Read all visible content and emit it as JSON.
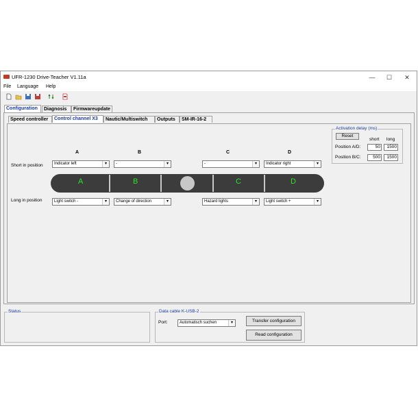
{
  "window": {
    "title": "UFR-1230 Drive-Teacher V1.11a"
  },
  "window_controls": {
    "minimize": "—",
    "maximize": "☐",
    "close": "✕"
  },
  "menu": {
    "file": "File",
    "language": "Language",
    "help": "Help"
  },
  "main_tabs": [
    "Configuration",
    "Diagnosis",
    "Firmwareupdate"
  ],
  "sub_tabs": [
    "Speed controller",
    "Control channel X3",
    "Nautic/Multiswitch",
    "Outputs",
    "SM-IR-16-2"
  ],
  "columns": {
    "a": "A",
    "b": "B",
    "c": "C",
    "d": "D"
  },
  "rows": {
    "short": "Short in position",
    "long": "Long in position"
  },
  "short_selects": {
    "a": "Indicator left",
    "b": "-",
    "c": "-",
    "d": "Indicator right"
  },
  "long_selects": {
    "a": "Light switch -",
    "b": "Change of direction",
    "c": "Hazard lights",
    "d": "Light switch +"
  },
  "bar_labels": {
    "a": "A",
    "b": "B",
    "c": "C",
    "d": "D"
  },
  "activation": {
    "legend": "Activation delay (ms)",
    "reset": "Reset",
    "short": "short",
    "long": "long",
    "pos_ad": "Position A/D:",
    "pos_bc": "Position B/C:",
    "ad_short": "50",
    "ad_long": "1500",
    "bc_short": "500",
    "bc_long": "1500"
  },
  "status": {
    "legend": "Status"
  },
  "cable": {
    "legend": "Data cable K-USB-2",
    "port_label": "Port:",
    "port_value": "Automatisch suchen",
    "transfer": "Transfer configuration",
    "read": "Read configuration"
  },
  "select_arrow": "▾",
  "colors": {
    "accent": "#1a3c9c",
    "bar": "#3c3c3c",
    "segment_text": "#27e627"
  }
}
